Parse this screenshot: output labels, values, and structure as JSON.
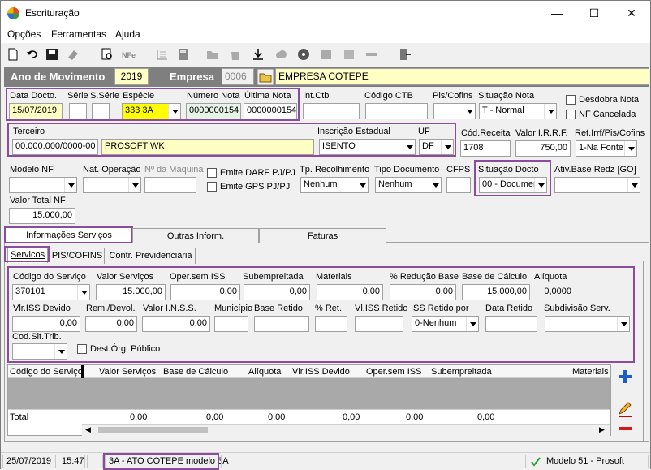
{
  "window": {
    "title": "Escrituração",
    "minimize": "—",
    "maximize": "☐",
    "close": "✕"
  },
  "menu": [
    "Opções",
    "Ferramentas",
    "Ajuda"
  ],
  "header": {
    "ano_label": "Ano de Movimento",
    "ano_value": "2019",
    "empresa_label": "Empresa",
    "empresa_code": "0006",
    "empresa_name": "EMPRESA COTEPE"
  },
  "row1": {
    "data_docto_label": "Data Docto.",
    "data_docto": "15/07/2019",
    "serie_label": "Série",
    "sserie_label": "S.Série",
    "especie_label": "Espécie",
    "especie": "333 3A",
    "numero_nota_label": "Número Nota",
    "numero_nota": "0000000154",
    "ultima_nota_label": "Última Nota",
    "ultima_nota": "0000000154",
    "int_ctb_label": "Int.Ctb",
    "codigo_ctb_label": "Código CTB",
    "pis_cofins_label": "Pis/Cofins",
    "situacao_nota_label": "Situação Nota",
    "situacao_nota": "T - Normal",
    "desdobra_nota": "Desdobra Nota",
    "nf_cancelada": "NF Cancelada"
  },
  "row2": {
    "terceiro_label": "Terceiro",
    "terceiro_code": "00.000.000/0000-00",
    "terceiro_name": "PROSOFT WK",
    "ie_label": "Inscrição Estadual",
    "ie_value": "ISENTO",
    "uf_label": "UF",
    "uf_value": "DF",
    "cod_receita_label": "Cód.Receita",
    "cod_receita": "1708",
    "valor_irrf_label": "Valor I.R.R.F.",
    "valor_irrf": "750,00",
    "ret_label": "Ret.Irrf/Pis/Cofins",
    "ret_value": "1-Na Fonte"
  },
  "row3": {
    "modelo_nf_label": "Modelo NF",
    "nat_operacao_label": "Nat. Operação",
    "maquina_label": "Nº da Máquina",
    "emite_darf": "Emite DARF PJ/PJ",
    "emite_gps": "Emite GPS PJ/PJ",
    "tp_recolhimento_label": "Tp. Recolhimento",
    "tp_recolhimento": "Nenhum",
    "tipo_documento_label": "Tipo Documento",
    "tipo_documento": "Nenhum",
    "cfps_label": "CFPS",
    "situacao_docto_label": "Situação Docto",
    "situacao_docto": "00 - Documen",
    "ativ_base_label": "Ativ.Base Redz [GO]"
  },
  "row4": {
    "valor_total_label": "Valor Total NF",
    "valor_total": "15.000,00"
  },
  "tabs": [
    "Informações Serviços",
    "Outras Inform.",
    "Faturas"
  ],
  "subtabs": [
    "Servicos",
    "PIS/COFINS",
    "Contr. Previdenciária"
  ],
  "serv": {
    "codigo_label": "Código do Serviço",
    "codigo": "370101",
    "valor_label": "Valor Serviços",
    "valor": "15.000,00",
    "oper_sem_iss_label": "Oper.sem ISS",
    "oper_sem_iss": "0,00",
    "subempreitada_label": "Subempreitada",
    "subempreitada": "0,00",
    "materiais_label": "Materiais",
    "materiais": "0,00",
    "reducao_label": "% Redução Base",
    "reducao": "0,00",
    "base_calculo_label": "Base de Cálculo",
    "base_calculo": "15.000,00",
    "aliquota_label": "Alíquota",
    "aliquota": "0,0000",
    "vlr_iss_label": "Vlr.ISS Devido",
    "vlr_iss": "0,00",
    "rem_label": "Rem./Devol.",
    "rem": "0,00",
    "inss_label": "Valor I.N.S.S.",
    "inss": "0,00",
    "municipio_label": "Município",
    "base_retido_label": "Base Retido",
    "ret_pct_label": "% Ret.",
    "vl_iss_retido_label": "Vl.ISS Retido",
    "iss_retido_por_label": "ISS Retido por",
    "iss_retido_por": "0-Nenhum",
    "data_retido_label": "Data Retido",
    "subdivisao_label": "Subdivisão Serv.",
    "cod_sit_trib_label": "Cod.Sit.Trib.",
    "dest_org": "Dest.Órg. Público"
  },
  "grid": {
    "columns": [
      "Código do Serviço",
      "Valor Serviços",
      "Base de Cálculo",
      "Alíquota",
      "Vlr.ISS Devido",
      "Oper.sem ISS",
      "Subempreitada",
      "Materiais"
    ],
    "total_label": "Total",
    "totals": [
      "0,00",
      "0,00",
      "0,00",
      "0,00",
      "0,00",
      "0,00"
    ]
  },
  "status": {
    "date": "25/07/2019",
    "time": "15:47",
    "message": "3A - ATO COTEPE modelo 3A",
    "model": "Modelo 51 - Prosoft"
  }
}
